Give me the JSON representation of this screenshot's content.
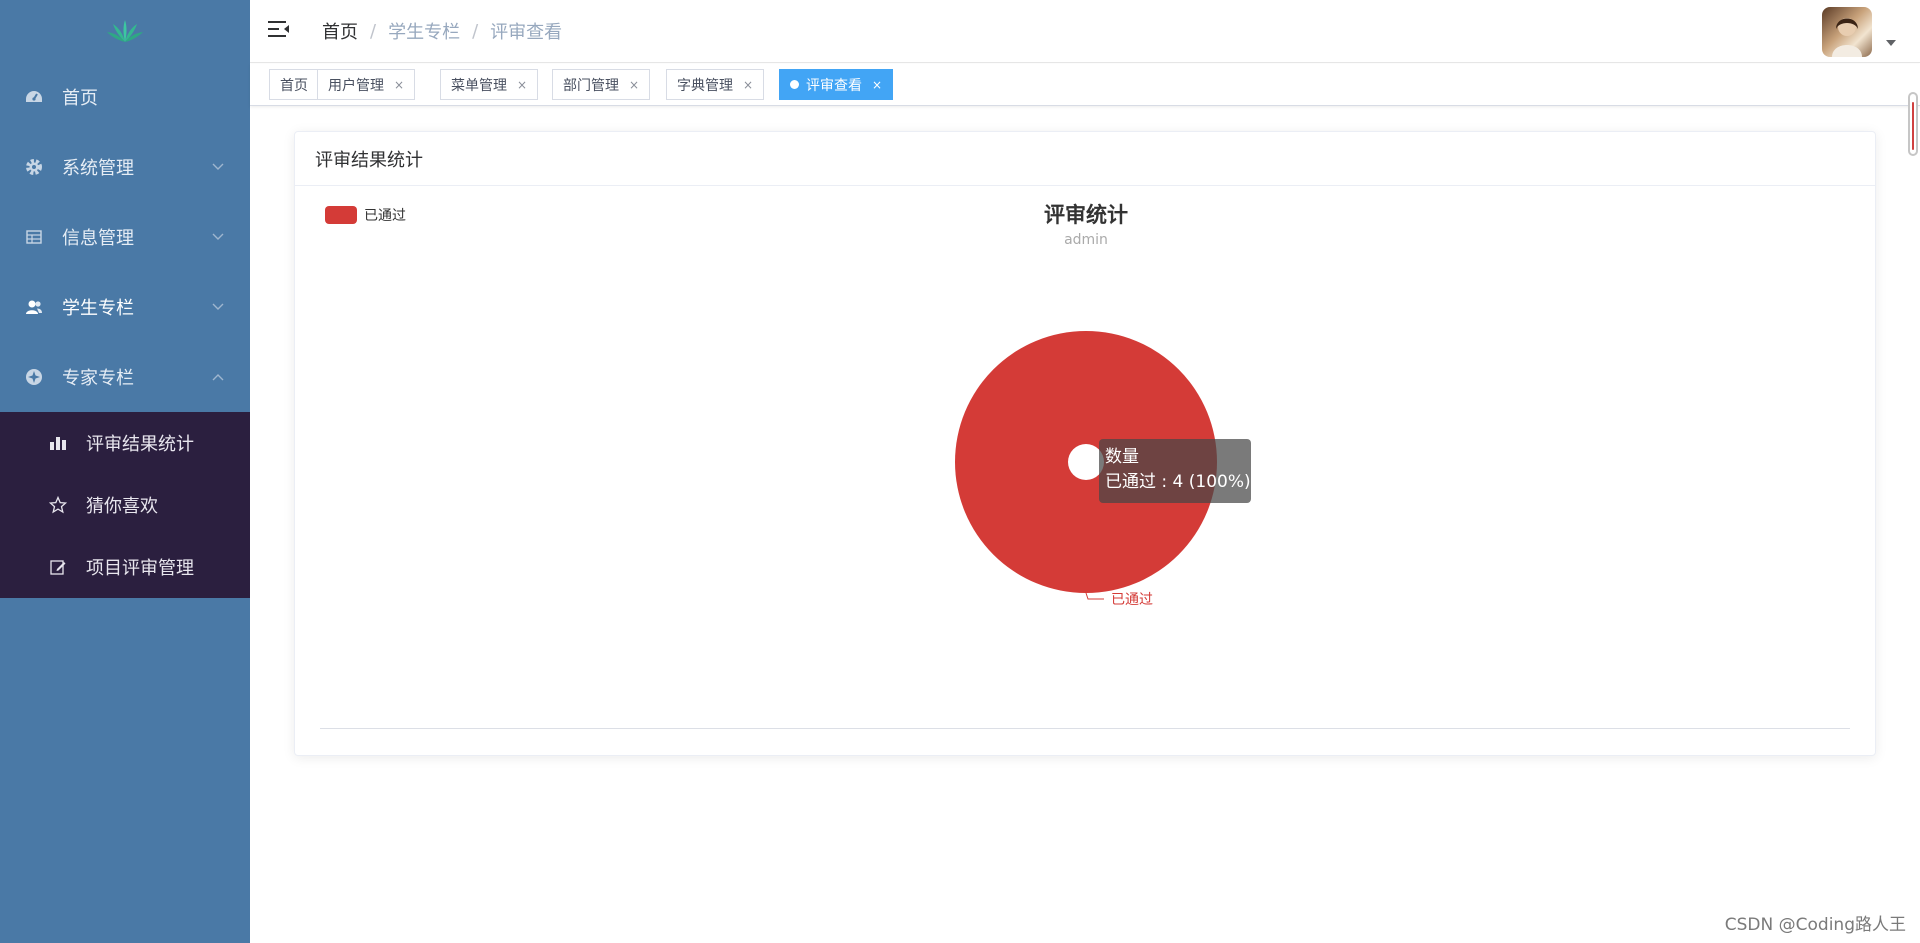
{
  "sidebar": {
    "logo_icon": "lotus-logo-icon",
    "items": [
      {
        "label": "首页",
        "icon": "dashboard-icon"
      },
      {
        "label": "系统管理",
        "icon": "gear-icon"
      },
      {
        "label": "信息管理",
        "icon": "table-icon"
      },
      {
        "label": "学生专栏",
        "icon": "user-group-icon"
      },
      {
        "label": "专家专栏",
        "icon": "compass-icon"
      }
    ],
    "submenu": [
      {
        "label": "评审结果统计",
        "icon": "bar-chart-icon"
      },
      {
        "label": "猜你喜欢",
        "icon": "star-icon"
      },
      {
        "label": "项目评审管理",
        "icon": "edit-icon"
      }
    ]
  },
  "header": {
    "breadcrumb": [
      "首页",
      "学生专栏",
      "评审查看"
    ],
    "breadcrumb_separator": "/"
  },
  "tags": [
    {
      "label": "首页"
    },
    {
      "label": "用户管理",
      "close": "×"
    },
    {
      "label": "菜单管理",
      "close": "×"
    },
    {
      "label": "部门管理",
      "close": "×"
    },
    {
      "label": "字典管理",
      "close": "×"
    },
    {
      "label": "评审查看",
      "close": "×",
      "active": true
    }
  ],
  "card": {
    "title": "评审结果统计"
  },
  "chart_data": {
    "type": "pie",
    "title": "评审统计",
    "subtitle": "admin",
    "legend": [
      "已通过"
    ],
    "legend_position": "top-left",
    "series": [
      {
        "name": "数量",
        "data": [
          {
            "name": "已通过",
            "value": 4
          }
        ]
      }
    ],
    "slice_label": "已通过",
    "tooltip": {
      "title": "数量",
      "line": "已通过 : 4 (100%)"
    },
    "colors": [
      "#d43b37"
    ]
  },
  "watermark": "CSDN @Coding路人王",
  "colors": {
    "sidebar_bg": "#4a79a6",
    "submenu_bg": "#2b1f3f",
    "active_tag": "#42a5f5",
    "pie": "#d43b37"
  }
}
